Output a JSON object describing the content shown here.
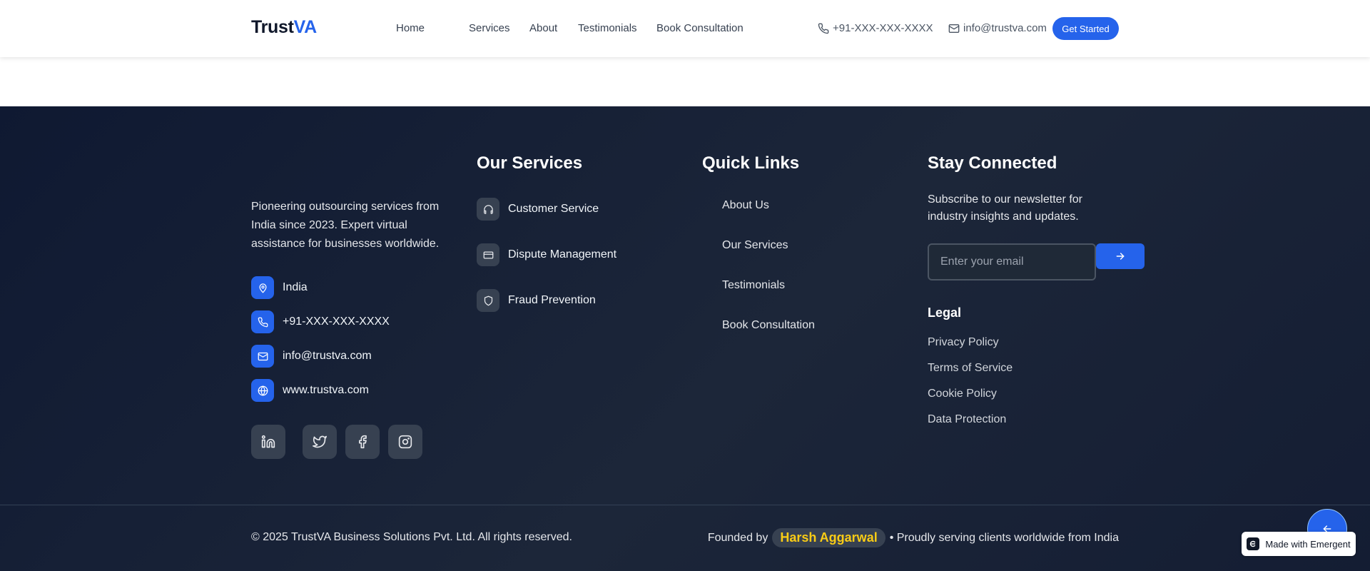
{
  "header": {
    "logo_main": "Trust",
    "logo_accent": "VA",
    "nav": [
      "Home",
      "Services",
      "About",
      "Testimonials",
      "Book Consultation"
    ],
    "phone": "+91-XXX-XXX-XXXX",
    "email": "info@trustva.com",
    "cta_label": "Get Started"
  },
  "footer": {
    "about_text": "Pioneering outsourcing services from India since 2023. Expert virtual assistance for businesses worldwide.",
    "contact_info": [
      {
        "icon": "map-pin-icon",
        "text": "India"
      },
      {
        "icon": "phone-icon",
        "text": "+91-XXX-XXX-XXXX"
      },
      {
        "icon": "mail-icon",
        "text": "info@trustva.com"
      },
      {
        "icon": "globe-icon",
        "text": "www.trustva.com"
      }
    ],
    "social": [
      "linkedin-icon",
      "twitter-icon",
      "facebook-icon",
      "instagram-icon"
    ],
    "services_title": "Our Services",
    "services": [
      {
        "icon": "headphones-icon",
        "label": "Customer Service"
      },
      {
        "icon": "credit-card-icon",
        "label": "Dispute Management"
      },
      {
        "icon": "shield-icon",
        "label": "Fraud Prevention"
      }
    ],
    "quick_links_title": "Quick Links",
    "quick_links": [
      "About Us",
      "Our Services",
      "Testimonials",
      "Book Consultation"
    ],
    "connect_title": "Stay Connected",
    "subscribe_text": "Subscribe to our newsletter for industry insights and updates.",
    "email_placeholder": "Enter your email",
    "legal_title": "Legal",
    "legal_links": [
      "Privacy Policy",
      "Terms of Service",
      "Cookie Policy",
      "Data Protection"
    ],
    "copyright": "© 2025 TrustVA Business Solutions Pvt. Ltd. All rights reserved.",
    "founded_prefix": "Founded by",
    "founder_name": "Harsh Aggarwal",
    "founded_suffix": "• Proudly serving clients worldwide from India"
  },
  "badge": {
    "label": "Made with Emergent"
  },
  "colors": {
    "accent": "#2563eb",
    "footer_bg": "#1c2639",
    "founder_highlight": "#facc15"
  }
}
